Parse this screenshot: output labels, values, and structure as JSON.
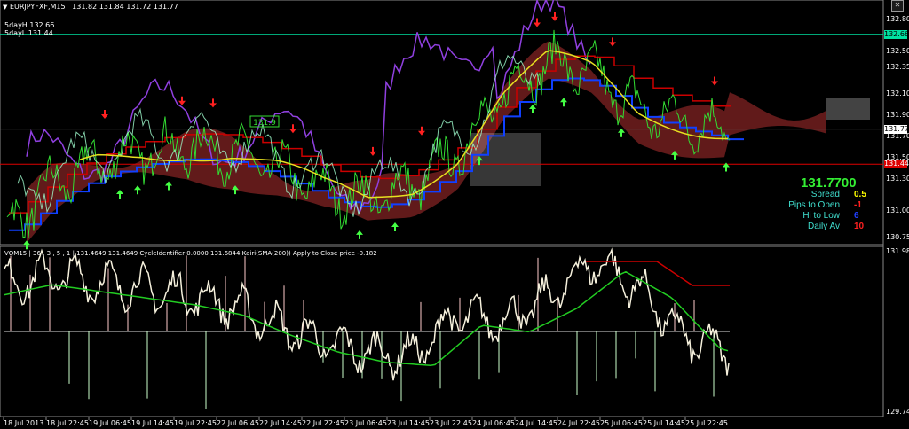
{
  "window": {
    "menu_icon": "dropdown-triangle-icon",
    "symbol": "EURJPYFXF,M15",
    "ohlc": "131.82 131.84 131.72 131.77",
    "close_icon": "close-x-icon"
  },
  "main_panel": {
    "lines": [
      "5dayH 132.66",
      "5dayL 131.44"
    ],
    "box_label": "131.9",
    "y_ticks": [
      "132.80",
      "132.50",
      "132.35",
      "132.10",
      "131.90",
      "131.70",
      "131.50",
      "131.30",
      "131.00",
      "130.75"
    ],
    "price_tags": [
      {
        "text": "132.66",
        "bg": "#00e0a0",
        "fg": "#000000"
      },
      {
        "text": "131.77",
        "bg": "#ffffff",
        "fg": "#000000"
      },
      {
        "text": "131.44",
        "bg": "#dd0000",
        "fg": "#ffffff"
      }
    ],
    "info": {
      "price": "131.7700",
      "rows": [
        {
          "label": "Spread",
          "value": "0.5",
          "label_color": "#40e0d0",
          "value_color": "#ffff00"
        },
        {
          "label": "Pips to Open",
          "value": "-1",
          "label_color": "#40e0d0",
          "value_color": "#ff2020"
        },
        {
          "label": "Hi to Low",
          "value": "6",
          "label_color": "#40e0d0",
          "value_color": "#2040ff"
        },
        {
          "label": "Daily Av",
          "value": "10",
          "label_color": "#40e0d0",
          "value_color": "#ff2020"
        }
      ]
    }
  },
  "sub_panel": {
    "header": "VQM15  |  36 , 3 , 5 , 1  |  131.4649  131.4649  CycleIdentifier 0.0000  131.6844  Kairi(SMA(200)) Apply to Close price -0.182",
    "y_ticks": [
      "131.984",
      "129.749"
    ]
  },
  "x_axis": [
    "18 Jul 2013",
    "18 Jul 22:45",
    "19 Jul 06:45",
    "19 Jul 14:45",
    "19 Jul 22:45",
    "22 Jul 06:45",
    "22 Jul 14:45",
    "22 Jul 22:45",
    "23 Jul 06:45",
    "23 Jul 14:45",
    "23 Jul 22:45",
    "24 Jul 06:45",
    "24 Jul 14:45",
    "24 Jul 22:45",
    "25 Jul 06:45",
    "25 Jul 14:45",
    "25 Jul 22:45"
  ],
  "colors": {
    "price": "#33dd33",
    "cyan_ma": "#30c8e8",
    "yellow_ma": "#e8e020",
    "purple": "#9040e0",
    "blue": "#1040ff",
    "red_line": "#cc0000",
    "cloud": "#b03030",
    "osc": "#f5f0dc"
  },
  "chart_data": [
    {
      "type": "line",
      "title": "EURJPYFXF,M15",
      "x": [
        "18 Jul 2013",
        "18 Jul 22:45",
        "19 Jul 06:45",
        "19 Jul 14:45",
        "19 Jul 22:45",
        "22 Jul 06:45",
        "22 Jul 14:45",
        "22 Jul 22:45",
        "23 Jul 06:45",
        "23 Jul 14:45",
        "23 Jul 22:45",
        "24 Jul 06:45",
        "24 Jul 14:45",
        "24 Jul 22:45",
        "25 Jul 06:45",
        "25 Jul 14:45",
        "25 Jul 22:45"
      ],
      "ylim": [
        130.7,
        132.9
      ],
      "series": [
        {
          "name": "5dayH",
          "values": [
            132.66,
            132.66,
            132.66,
            132.66,
            132.66,
            132.66,
            132.66,
            132.66,
            132.66,
            132.66,
            132.66,
            132.66,
            132.66,
            132.66,
            132.66,
            132.66,
            132.66
          ]
        },
        {
          "name": "5dayL",
          "values": [
            131.44,
            131.44,
            131.44,
            131.44,
            131.44,
            131.44,
            131.44,
            131.44,
            131.44,
            131.44,
            131.44,
            131.44,
            131.44,
            131.44,
            131.44,
            131.44,
            131.44
          ]
        },
        {
          "name": "",
          "values": [
            130.85,
            131.25,
            131.45,
            131.55,
            131.6,
            131.55,
            131.4,
            131.2,
            131.1,
            131.25,
            131.55,
            132.1,
            132.4,
            132.3,
            131.95,
            131.85,
            131.75
          ]
        }
      ]
    },
    {
      "type": "line",
      "title": "VQM15",
      "ylim": [
        129.749,
        131.984
      ],
      "x": [
        "18 Jul 2013",
        "18 Jul 22:45",
        "19 Jul 06:45",
        "19 Jul 14:45",
        "19 Jul 22:45",
        "22 Jul 06:45",
        "22 Jul 14:45",
        "22 Jul 22:45",
        "23 Jul 06:45",
        "23 Jul 14:45",
        "23 Jul 22:45",
        "24 Jul 06:45",
        "24 Jul 14:45",
        "24 Jul 22:45",
        "25 Jul 06:45",
        "25 Jul 14:45",
        "25 Jul 22:45"
      ],
      "series": [
        {
          "name": "",
          "values": [
            131.6,
            131.75,
            131.65,
            131.55,
            131.45,
            131.3,
            131.0,
            130.75,
            130.6,
            130.55,
            131.15,
            131.05,
            131.4,
            131.95,
            131.55,
            130.8,
            130.62
          ]
        }
      ]
    }
  ]
}
